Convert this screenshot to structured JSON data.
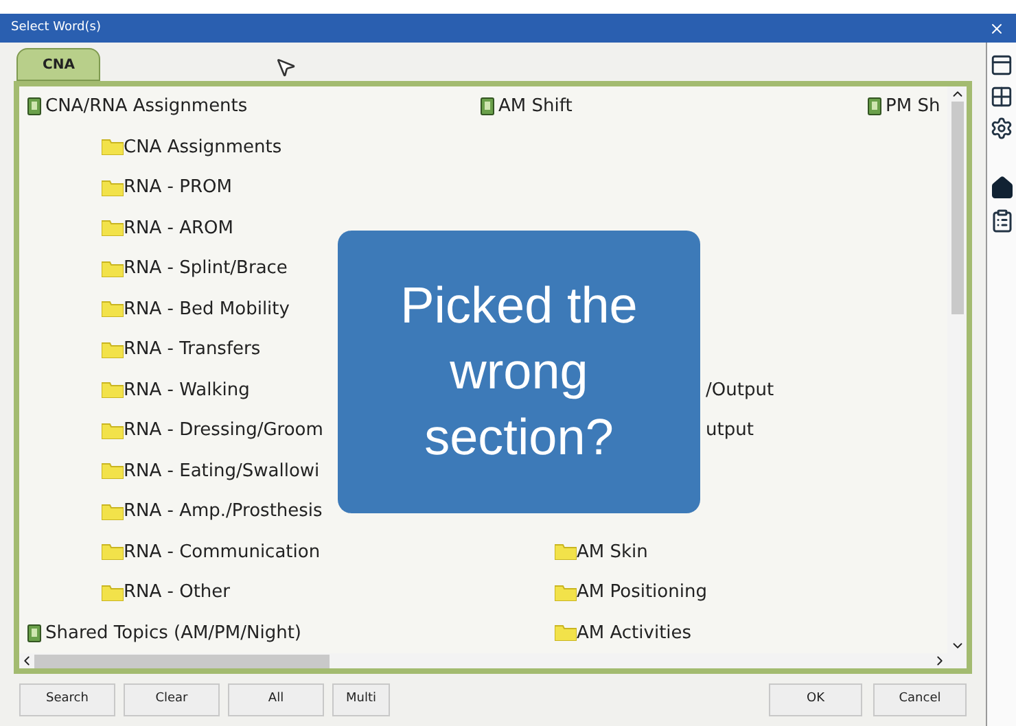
{
  "window": {
    "title": "Select Word(s)"
  },
  "tabs": [
    {
      "label": "CNA",
      "selected": true
    }
  ],
  "columns": [
    {
      "header": "CNA/RNA Assignments"
    },
    {
      "header": "AM Shift"
    },
    {
      "header": "PM Sh"
    }
  ],
  "left_items": [
    "CNA Assignments",
    "RNA - PROM",
    "RNA - AROM",
    "RNA - Splint/Brace",
    "RNA - Bed Mobility",
    "RNA - Transfers",
    "RNA - Walking",
    "RNA - Dressing/Groom",
    "RNA - Eating/Swallowi",
    "RNA - Amp./Prosthesis",
    "RNA - Communication",
    "RNA - Other"
  ],
  "right_items": [
    {
      "label": "/Output",
      "kind": "clipped"
    },
    {
      "label": "utput",
      "kind": "clipped"
    },
    {
      "label": "AM Skin",
      "kind": "folder"
    },
    {
      "label": "AM Positioning",
      "kind": "folder"
    },
    {
      "label": "AM Activities",
      "kind": "folder"
    }
  ],
  "shared_topic": "Shared Topics (AM/PM/Night)",
  "overlay": {
    "text": "Picked the wrong section?"
  },
  "buttons_left": [
    "Search",
    "Clear",
    "All",
    "Multi"
  ],
  "buttons_right": [
    "OK",
    "Cancel"
  ]
}
